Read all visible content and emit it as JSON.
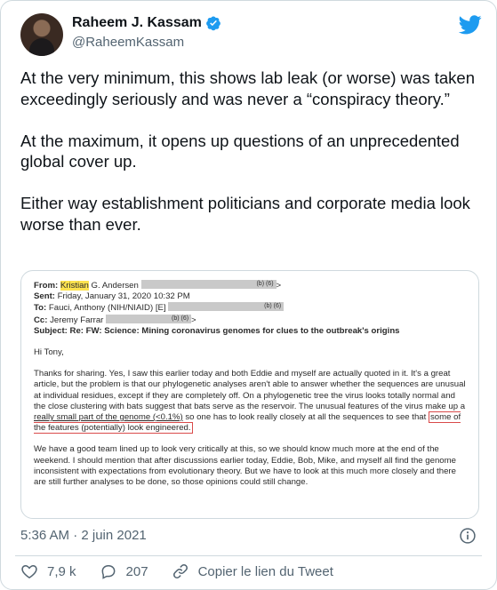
{
  "author": {
    "display_name": "Raheem J. Kassam",
    "handle": "@RaheemKassam",
    "verified": true
  },
  "tweet": {
    "paragraphs": [
      "At the very minimum, this shows lab leak (or worse) was taken exceedingly seriously and was never a “conspiracy theory.”",
      "At the maximum, it opens up questions of an unprecedented global cover up.",
      "Either way establishment politicians and corporate media look worse than ever."
    ]
  },
  "document": {
    "from_label": "From:",
    "from_first": "Kristian",
    "from_rest": " G. Andersen",
    "from_redact_code": "(b) (6)",
    "from_end": ">",
    "sent_label": "Sent:",
    "sent_value": " Friday, January 31, 2020 10:32 PM",
    "to_label": "To:",
    "to_value": " Fauci, Anthony (NIH/NIAID) [E]",
    "to_redact_code": "(b) (6)",
    "cc_label": "Cc:",
    "cc_value": " Jeremy Farrar",
    "cc_redact_code": "(b) (6)",
    "cc_end": ">",
    "subject_label": "Subject:",
    "subject_value": " Re: FW: Science: Mining coronavirus genomes for clues to the outbreak's origins",
    "greeting": "Hi Tony,",
    "para1_a": "Thanks for sharing. Yes, I saw this earlier today and both Eddie and myself are actually quoted in it. It's a great article, but the problem is that our phylogenetic analyses aren't able to answer whether the sequences are unusual at individual residues, except if they are completely off. On a phylogenetic tree the virus looks totally normal and the close clustering with bats suggest that bats serve as the reservoir. The unusual features of the virus make up a ",
    "para1_underline": "really small part of the genome (<0.1%)",
    "para1_b": " so one has to look really closely at all the sequences to see that ",
    "para1_boxed": "some of the features (potentially) look engineered.",
    "para2": "We have a good team lined up to look very critically at this, so we should know much more at the end of the weekend. I should mention that after discussions earlier today, Eddie, Bob, Mike, and myself all find the genome inconsistent with expectations from evolutionary theory. But we have to look at this much more closely and there are still further analyses to be done, so those opinions could still change."
  },
  "meta": {
    "timestamp": "5:36 AM · 2 juin 2021"
  },
  "actions": {
    "likes": "7,9 k",
    "replies": "207",
    "copy_link": "Copier le lien du Tweet"
  },
  "colors": {
    "brand": "#1d9bf0",
    "text": "#0f1419",
    "secondary": "#536471",
    "highlight": "#fde24f",
    "box": "#d94a4a"
  }
}
